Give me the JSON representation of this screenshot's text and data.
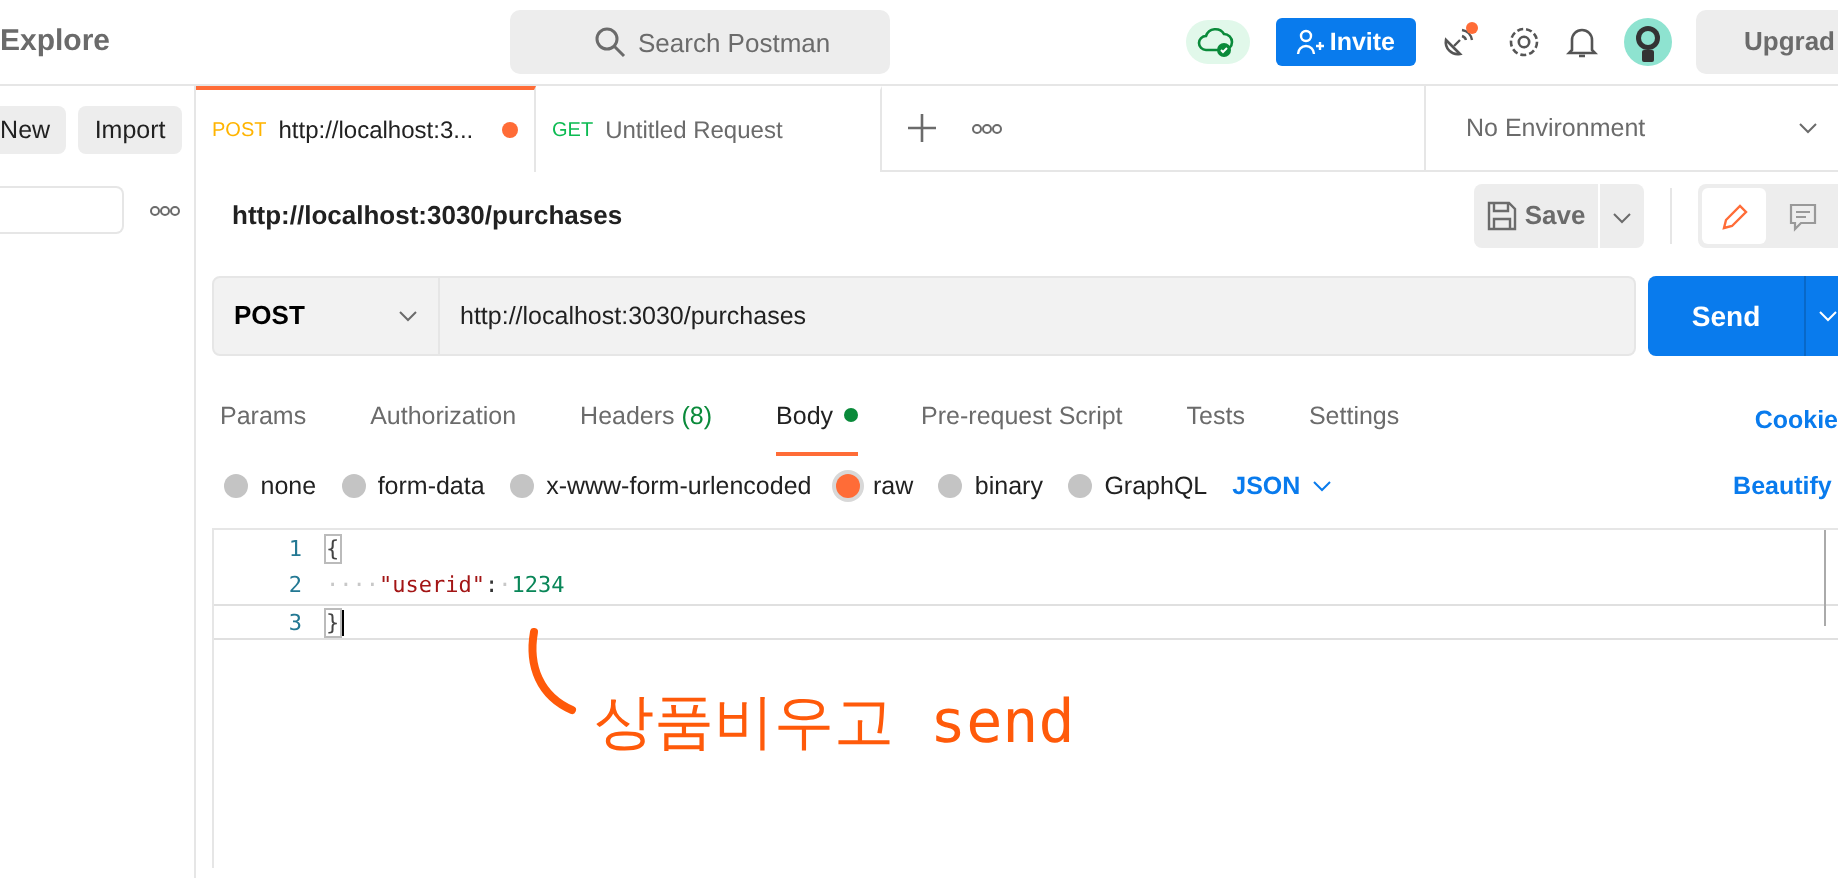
{
  "topbar": {
    "title": "Explore",
    "search": {
      "placeholder": "Search Postman"
    },
    "invite": "Invite",
    "upgrade": "Upgrad"
  },
  "sidebar": {
    "buttons": [
      "New",
      "Import"
    ]
  },
  "tabs": [
    {
      "method": "POST",
      "color": "#ffb400",
      "title": "http://localhost:3...",
      "selected": true,
      "unsaved": true
    },
    {
      "method": "GET",
      "color": "#0cbb52",
      "title": "Untitled Request",
      "selected": false,
      "unsaved": false
    }
  ],
  "environment": "No Environment",
  "request": {
    "title": "http://localhost:3030/purchases",
    "save": "Save",
    "method": "POST",
    "url": "http://localhost:3030/purchases",
    "send": "Send"
  },
  "request_tabs": [
    {
      "label": "Params",
      "selected": false
    },
    {
      "label": "Authorization",
      "selected": false
    },
    {
      "label": "Headers",
      "count": "(8)",
      "selected": false
    },
    {
      "label": "Body",
      "selected": true,
      "has_content": true
    },
    {
      "label": "Pre-request Script",
      "selected": false
    },
    {
      "label": "Tests",
      "selected": false
    },
    {
      "label": "Settings",
      "selected": false
    }
  ],
  "cookies": "Cookie",
  "body_modes": [
    {
      "label": "none",
      "selected": false
    },
    {
      "label": "form-data",
      "selected": false
    },
    {
      "label": "x-www-form-urlencoded",
      "selected": false
    },
    {
      "label": "raw",
      "selected": true
    },
    {
      "label": "binary",
      "selected": false
    },
    {
      "label": "GraphQL",
      "selected": false
    }
  ],
  "format": "JSON",
  "beautify": "Beautify",
  "editor": {
    "lines": [
      {
        "number": "1",
        "selected": false,
        "tokens": [
          {
            "kind": "bracket",
            "text": "{"
          }
        ]
      },
      {
        "number": "2",
        "selected": false,
        "tokens": [
          {
            "kind": "space",
            "text": "····"
          },
          {
            "kind": "key",
            "text": "\"userid\""
          },
          {
            "kind": "punct",
            "text": ":"
          },
          {
            "kind": "space",
            "text": "·"
          },
          {
            "kind": "number",
            "text": "1234"
          }
        ]
      },
      {
        "number": "3",
        "selected": true,
        "tokens": [
          {
            "kind": "bracket",
            "text": "}"
          }
        ]
      }
    ]
  },
  "annotation": {
    "text": "상품비우고 send"
  }
}
